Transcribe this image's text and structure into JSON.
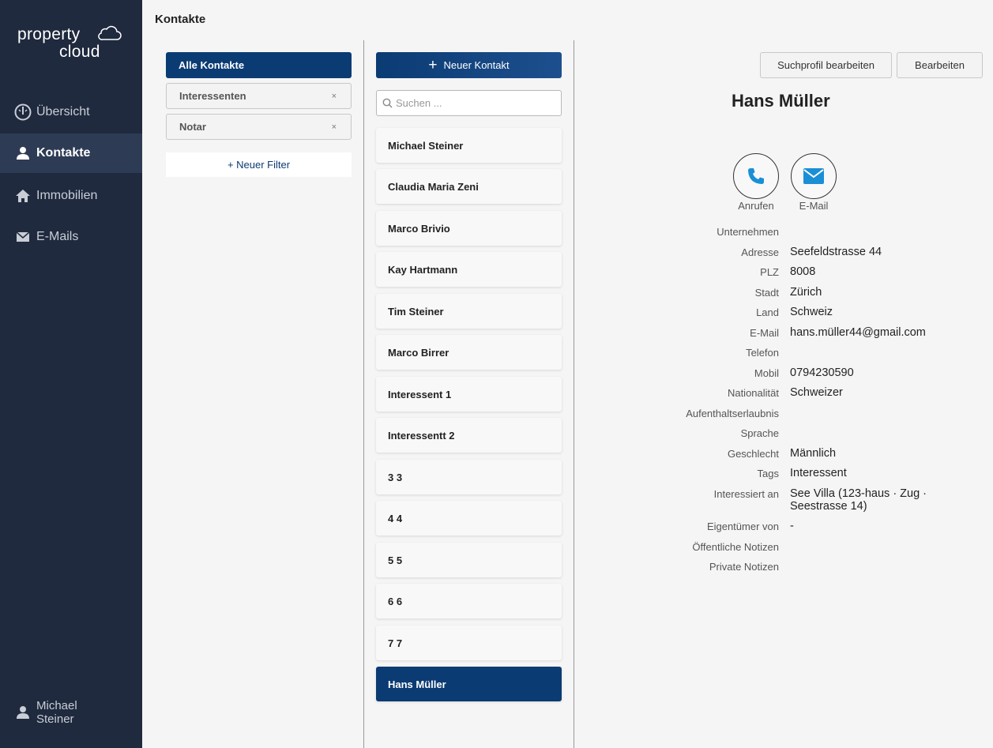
{
  "brand": {
    "line1": "property",
    "line2": "cloud"
  },
  "nav": {
    "items": [
      {
        "label": "Übersicht",
        "icon": "gauge-icon"
      },
      {
        "label": "Kontakte",
        "icon": "person-icon"
      },
      {
        "label": "Immobilien",
        "icon": "home-icon"
      },
      {
        "label": "E-Mails",
        "icon": "mail-icon"
      }
    ],
    "active": "Kontakte"
  },
  "user": {
    "first": "Michael",
    "last": "Steiner"
  },
  "header": {
    "title": "Kontakte"
  },
  "filters": {
    "all": "Alle Kontakte",
    "tags": [
      {
        "label": "Interessenten",
        "remove": "×"
      },
      {
        "label": "Notar",
        "remove": "×"
      }
    ],
    "new_filter": "+ Neuer Filter"
  },
  "contacts": {
    "new_label": "Neuer Kontakt",
    "search_placeholder": "Suchen ...",
    "items": [
      "Michael Steiner",
      "Claudia Maria Zeni",
      "Marco Brivio",
      "Kay Hartmann",
      "Tim Steiner",
      "Marco Birrer",
      "Interessent 1",
      "Interessentt 2",
      "3 3",
      "4 4",
      "5 5",
      "6 6",
      "7 7",
      "Hans Müller"
    ],
    "selected": "Hans Müller"
  },
  "detail": {
    "buttons": {
      "search_profile": "Suchprofil bearbeiten",
      "edit": "Bearbeiten"
    },
    "name": "Hans Müller",
    "actions": {
      "call": "Anrufen",
      "email": "E-Mail"
    },
    "fields": [
      {
        "key": "Unternehmen",
        "value": ""
      },
      {
        "key": "Adresse",
        "value": "Seefeldstrasse 44"
      },
      {
        "key": "PLZ",
        "value": "8008"
      },
      {
        "key": "Stadt",
        "value": "Zürich"
      },
      {
        "key": "Land",
        "value": "Schweiz"
      },
      {
        "key": "E-Mail",
        "value": "hans.müller44@gmail.com"
      },
      {
        "key": "Telefon",
        "value": ""
      },
      {
        "key": "Mobil",
        "value": "0794230590"
      },
      {
        "key": "Nationalität",
        "value": "Schweizer"
      },
      {
        "key": "Aufenthaltserlaubnis",
        "value": ""
      },
      {
        "key": "Sprache",
        "value": ""
      },
      {
        "key": "Geschlecht",
        "value": "Männlich"
      },
      {
        "key": "Tags",
        "value": "Interessent"
      },
      {
        "key": "Interessiert an",
        "value": "See Villa (123-haus · Zug · Seestrasse 14)"
      },
      {
        "key": "Eigentümer von",
        "value": "-"
      },
      {
        "key": "Öffentliche Notizen",
        "value": ""
      },
      {
        "key": "Private Notizen",
        "value": ""
      }
    ]
  },
  "colors": {
    "sidebar": "#1f2a3e",
    "accent": "#0b3b73",
    "action_icon": "#1a8fd6"
  }
}
